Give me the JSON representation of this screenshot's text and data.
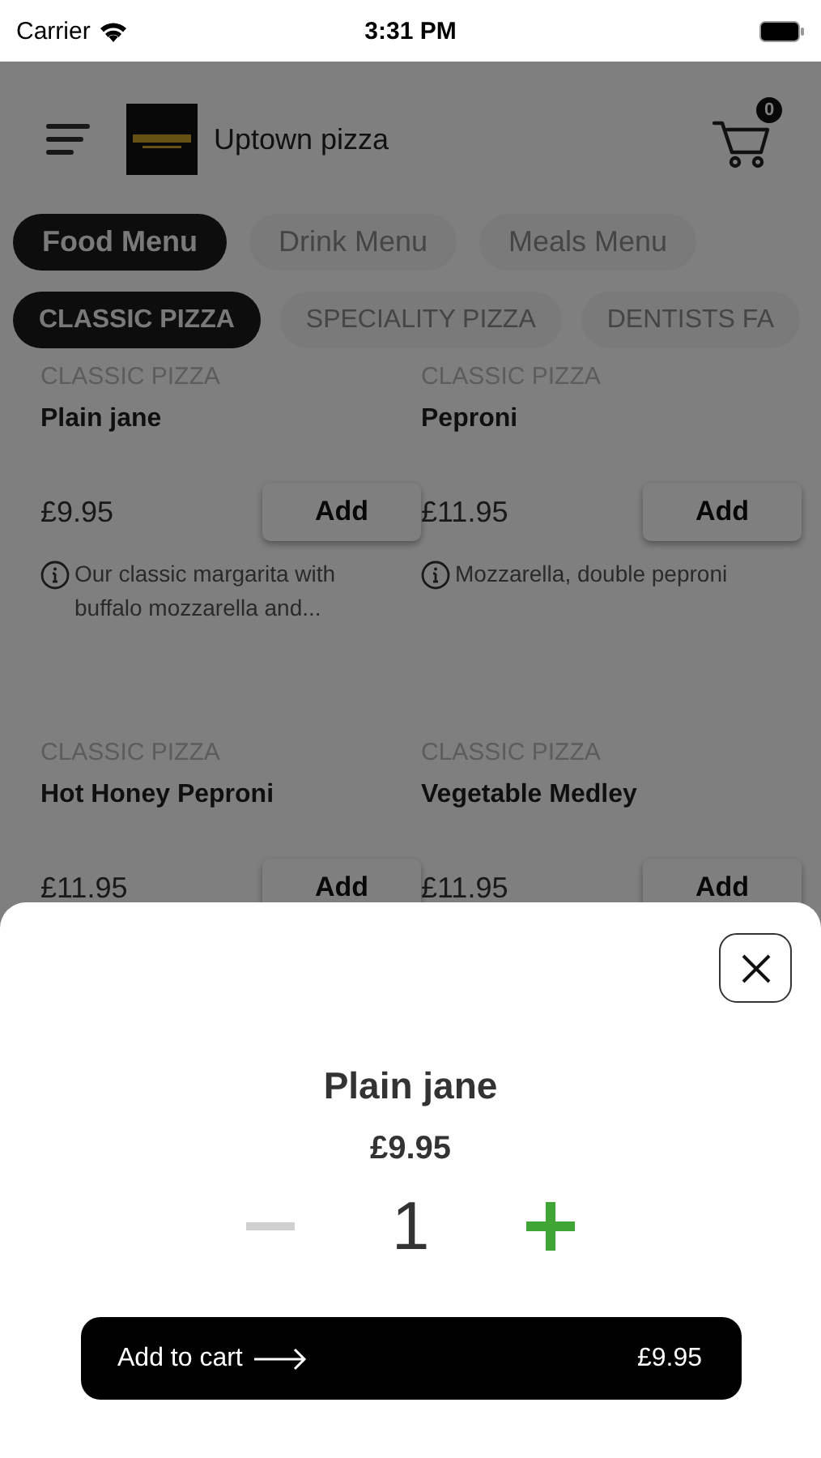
{
  "status_bar": {
    "carrier": "Carrier",
    "time": "3:31 PM"
  },
  "header": {
    "brand": "Uptown pizza",
    "cart_count": "0"
  },
  "menu_tabs": [
    {
      "label": "Food Menu",
      "selected": true
    },
    {
      "label": "Drink Menu",
      "selected": false
    },
    {
      "label": "Meals Menu",
      "selected": false
    }
  ],
  "categories": [
    {
      "label": "CLASSIC PIZZA",
      "selected": true
    },
    {
      "label": "SPECIALITY PIZZA",
      "selected": false
    },
    {
      "label": "DENTISTS FA",
      "selected": false
    }
  ],
  "items": [
    {
      "category": "CLASSIC PIZZA",
      "name": "Plain jane",
      "price": "£9.95",
      "add_label": "Add",
      "description": "Our classic margarita with buffalo mozzarella and..."
    },
    {
      "category": "CLASSIC PIZZA",
      "name": "Peproni",
      "price": "£11.95",
      "add_label": "Add",
      "description": "Mozzarella, double peproni"
    },
    {
      "category": "CLASSIC PIZZA",
      "name": "Hot Honey Peproni",
      "price": "£11.95",
      "add_label": "Add"
    },
    {
      "category": "CLASSIC PIZZA",
      "name": "Vegetable Medley",
      "price": "£11.95",
      "add_label": "Add"
    }
  ],
  "sheet": {
    "name": "Plain jane",
    "price": "£9.95",
    "quantity": "1",
    "decrement_disabled": true,
    "add_to_cart_label": "Add to cart",
    "total": "£9.95"
  }
}
